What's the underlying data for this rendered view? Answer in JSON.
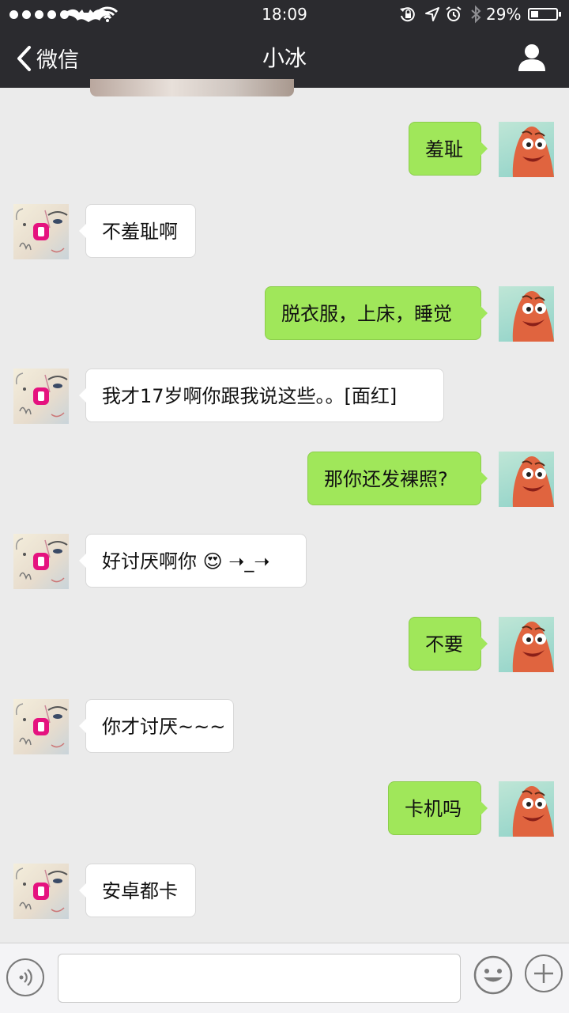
{
  "status_bar": {
    "signal_dots": 5,
    "time": "18:09",
    "battery_percent_text": "29%",
    "battery_level": 0.29,
    "icons": [
      "batman-carrier-icon",
      "wifi-icon",
      "rotation-lock-icon",
      "location-icon",
      "alarm-icon",
      "bluetooth-icon",
      "battery-icon"
    ]
  },
  "nav_bar": {
    "back_label": "微信",
    "title": "小冰",
    "icons": [
      "back-chevron-icon",
      "profile-icon"
    ]
  },
  "messages": [
    {
      "from": "me",
      "text": "羞耻"
    },
    {
      "from": "other",
      "text": "不羞耻啊"
    },
    {
      "from": "me",
      "text": "脱衣服，上床，睡觉"
    },
    {
      "from": "other",
      "text": "我才17岁啊你跟我说这些。。[面红]"
    },
    {
      "from": "me",
      "text": "那你还发裸照?"
    },
    {
      "from": "other",
      "text": "好讨厌啊你 😍 ➝_➝"
    },
    {
      "from": "me",
      "text": "不要"
    },
    {
      "from": "other",
      "text": "你才讨厌~~~"
    },
    {
      "from": "me",
      "text": "卡机吗"
    },
    {
      "from": "other",
      "text": "安卓都卡"
    }
  ],
  "input_bar": {
    "input_value": "",
    "icons": [
      "voice-icon",
      "emoji-icon",
      "plus-icon"
    ]
  },
  "colors": {
    "header_bg": "#2b2b2f",
    "chat_bg": "#ebebeb",
    "my_bubble": "#a0e75a",
    "other_bubble": "#ffffff"
  }
}
